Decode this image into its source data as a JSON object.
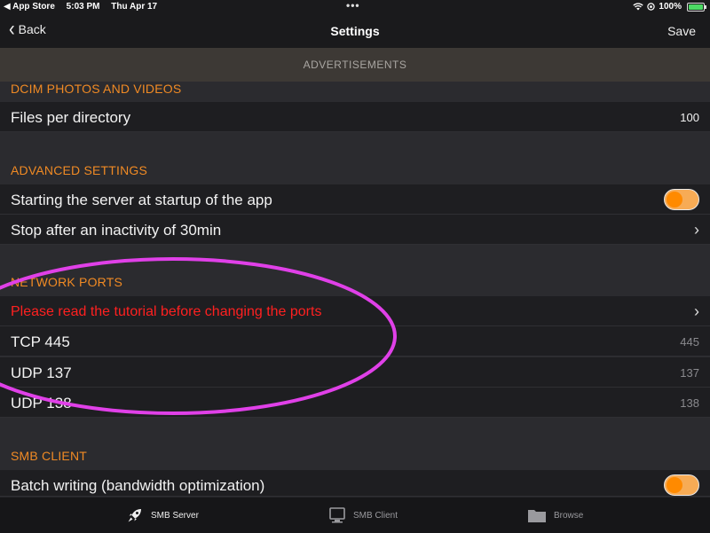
{
  "status_bar": {
    "back_app": "◀ App Store",
    "time": "5:03 PM",
    "date": "Thu Apr 17",
    "dots": "•••",
    "battery": "100%"
  },
  "nav": {
    "back_label": "Back",
    "title": "Settings",
    "save_label": "Save"
  },
  "ad_banner": "ADVERTISEMENTS",
  "sections": {
    "dcim": {
      "title": "DCIM PHOTOS AND VIDEOS",
      "files_per_directory": {
        "label": "Files per directory",
        "value": "100"
      }
    },
    "advanced": {
      "title": "ADVANCED SETTINGS",
      "startup": {
        "label": "Starting the server at startup of the app",
        "enabled": true
      },
      "inactivity": {
        "label": "Stop after an inactivity of 30min"
      }
    },
    "network_ports": {
      "title": "NETWORK PORTS",
      "tutorial": {
        "label": "Please read the tutorial before changing the ports"
      },
      "tcp445": {
        "label": "TCP 445",
        "value": "445"
      },
      "udp137": {
        "label": "UDP 137",
        "value": "137"
      },
      "udp138": {
        "label": "UDP 138",
        "value": "138"
      }
    },
    "smb_client": {
      "title": "SMB CLIENT",
      "batch": {
        "label": "Batch writing (bandwidth optimization)",
        "enabled": true
      }
    }
  },
  "tabs": [
    {
      "label": "SMB Server",
      "icon": "rocket-icon",
      "active": true
    },
    {
      "label": "SMB Client",
      "icon": "monitor-icon",
      "active": false
    },
    {
      "label": "Browse",
      "icon": "folder-icon",
      "active": false
    }
  ],
  "colors": {
    "accent_orange": "#f08a24",
    "warning_red": "#ff2020",
    "highlight_magenta": "#e040e8"
  }
}
